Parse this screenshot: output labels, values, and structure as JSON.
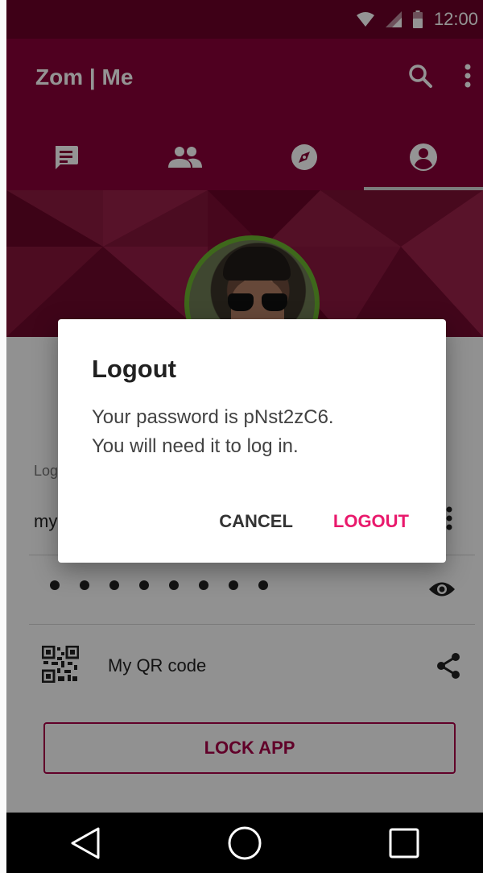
{
  "status_bar": {
    "time": "12:00",
    "icons": [
      "wifi-icon",
      "signal-icon",
      "battery-icon"
    ]
  },
  "app_bar": {
    "title": "Zom | Me",
    "actions": [
      "search-icon",
      "more-vert-icon"
    ],
    "tabs": [
      {
        "name": "chats",
        "icon": "chat-icon",
        "active": false
      },
      {
        "name": "contacts",
        "icon": "people-icon",
        "active": false
      },
      {
        "name": "discover",
        "icon": "compass-icon",
        "active": false
      },
      {
        "name": "me",
        "icon": "account-circle-icon",
        "active": true
      }
    ]
  },
  "profile": {
    "login_label": "Log",
    "username": "my",
    "password_mask": "••••••••",
    "qr_label": "My QR code",
    "lock_button": "LOCK APP"
  },
  "dialog": {
    "title": "Logout",
    "message": "Your password is pNst2zC6.\nYou will need it to log in.",
    "cancel": "CANCEL",
    "confirm": "LOGOUT"
  },
  "colors": {
    "app_bar": "#880038",
    "status_bar": "#6b0028",
    "accent": "#e9196c",
    "lock_button": "#a70048",
    "avatar_ring": "#6cb42f"
  },
  "nav_bar": [
    "back-icon",
    "home-icon",
    "recents-icon"
  ]
}
